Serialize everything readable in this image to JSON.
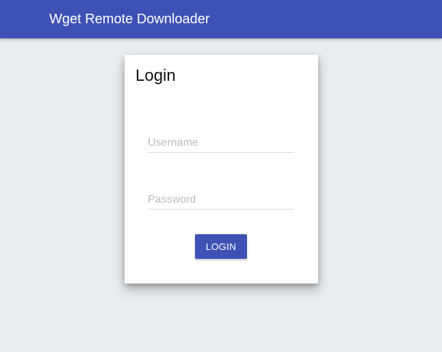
{
  "app": {
    "title": "Wget Remote Downloader"
  },
  "login": {
    "title": "Login",
    "username_placeholder": "Username",
    "password_placeholder": "Password",
    "button_label": "LOGIN"
  },
  "colors": {
    "primary": "#3f51b5",
    "background": "#e9edf0",
    "card": "#ffffff"
  }
}
